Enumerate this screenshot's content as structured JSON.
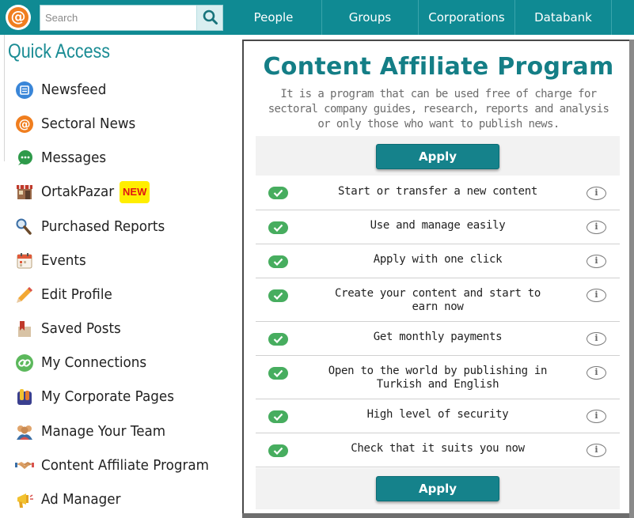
{
  "header": {
    "logo_glyph": "@",
    "search_placeholder": "Search",
    "nav": [
      "People",
      "Groups",
      "Corporations",
      "Databank"
    ]
  },
  "sidebar": {
    "title": "Quick Access",
    "items": [
      {
        "label": "Newsfeed",
        "icon": "newsfeed-icon"
      },
      {
        "label": "Sectoral News",
        "icon": "sectoral-news-icon"
      },
      {
        "label": "Messages",
        "icon": "messages-icon"
      },
      {
        "label": "OrtakPazar",
        "icon": "store-icon",
        "badge": "NEW"
      },
      {
        "label": "Purchased Reports",
        "icon": "magnifier-report-icon"
      },
      {
        "label": "Events",
        "icon": "calendar-icon"
      },
      {
        "label": "Edit Profile",
        "icon": "pencil-icon"
      },
      {
        "label": "Saved Posts",
        "icon": "bookmark-icon"
      },
      {
        "label": "My Connections",
        "icon": "link-icon"
      },
      {
        "label": "My Corporate Pages",
        "icon": "corporate-icon"
      },
      {
        "label": "Manage Your Team",
        "icon": "team-icon"
      },
      {
        "label": "Content Affiliate Program",
        "icon": "handshake-icon"
      },
      {
        "label": "Ad Manager",
        "icon": "megaphone-icon"
      }
    ]
  },
  "main": {
    "title": "Content Affiliate Program",
    "description": "It is a program that can be used free of charge for sectoral company guides, research, reports and analysis or only those who want to publish news.",
    "apply_label": "Apply",
    "features": [
      {
        "line1": "Start or transfer a new content",
        "line2": ""
      },
      {
        "line1": "Use and manage easily",
        "line2": ""
      },
      {
        "line1": "Apply with one click",
        "line2": ""
      },
      {
        "line1": "Create your content and start to",
        "line2": "earn now"
      },
      {
        "line1": "Get monthly payments",
        "line2": ""
      },
      {
        "line1": "Open to the world by publishing in",
        "line2": "Turkish and English"
      },
      {
        "line1": "High level of security",
        "line2": ""
      },
      {
        "line1": "Check that it suits you now",
        "line2": ""
      }
    ],
    "info_glyph": "i"
  },
  "colors": {
    "header_teal": "#0f8a93",
    "accent_orange": "#f07e1f",
    "button_teal": "#15828b",
    "check_green": "#47ad5f",
    "badge_yellow": "#ffee00",
    "badge_red": "#e01515"
  }
}
